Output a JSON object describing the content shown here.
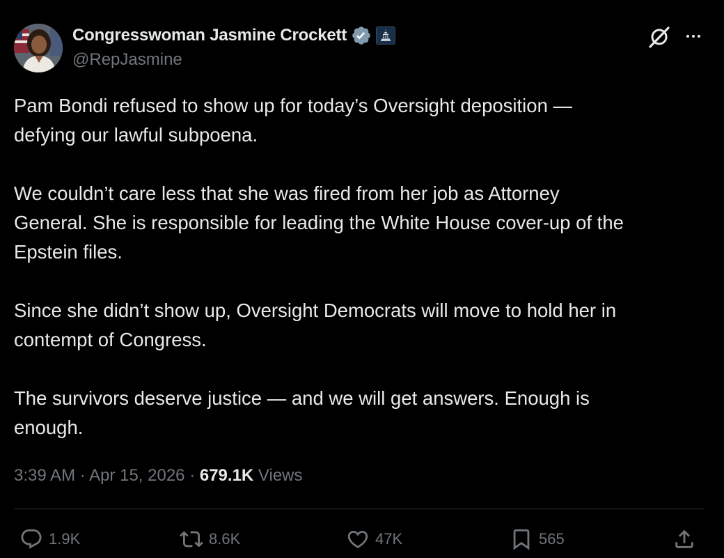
{
  "author": {
    "display_name": "Congresswoman Jasmine Crockett",
    "handle": "@RepJasmine"
  },
  "icons": {
    "avatar": "profile-photo",
    "verified": "verified-badge-icon",
    "affiliation": "capitol-dome-icon",
    "grok": "grok-icon",
    "more": "more-icon",
    "reply": "reply-icon",
    "repost": "repost-icon",
    "like": "heart-icon",
    "bookmark": "bookmark-icon",
    "share": "share-icon"
  },
  "colors": {
    "background": "#000000",
    "text": "#e7e9ea",
    "muted": "#71767b",
    "verified": "#829aab",
    "divider": "#2f3336"
  },
  "post": {
    "paragraphs": [
      "Pam Bondi refused to show up for today’s Oversight deposition —\ndefying our lawful subpoena.",
      "We couldn’t care less that she was fired from her job as Attorney\nGeneral. She is responsible for leading the White House cover-up of the\nEpstein files.",
      "Since she didn’t show up, Oversight Democrats will move to hold her in\ncontempt of Congress.",
      "The survivors deserve justice — and we will get answers. Enough is\nenough."
    ],
    "time": "3:39 AM",
    "separator": "·",
    "date": "Apr 15, 2026",
    "views_count": "679.1K",
    "views_label": "Views"
  },
  "actions": {
    "replies": "1.9K",
    "reposts": "8.6K",
    "likes": "47K",
    "bookmarks": "565"
  }
}
